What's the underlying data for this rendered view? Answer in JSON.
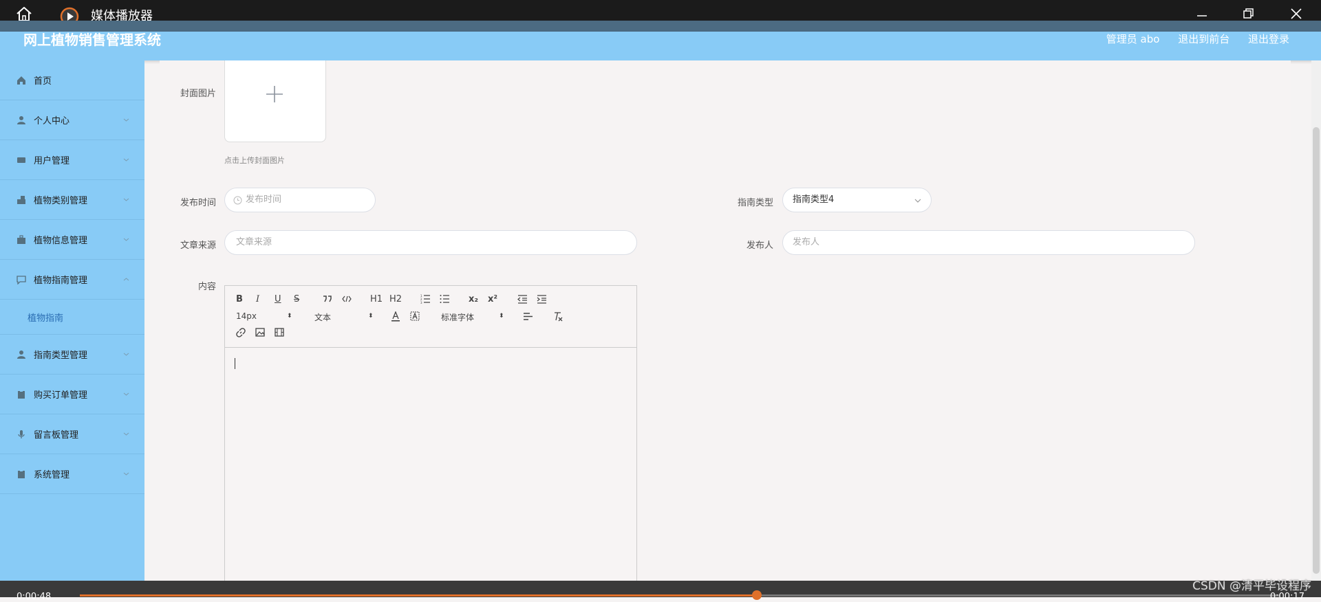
{
  "window": {
    "title": "媒体播放器"
  },
  "header": {
    "brand": "网上植物销售管理系统",
    "admin": "管理员 abo",
    "to_front": "退出到前台",
    "logout": "退出登录"
  },
  "sidebar": {
    "items": [
      {
        "label": "首页",
        "icon": "home-icon"
      },
      {
        "label": "个人中心",
        "icon": "user-icon"
      },
      {
        "label": "用户管理",
        "icon": "users-icon"
      },
      {
        "label": "植物类别管理",
        "icon": "category-icon"
      },
      {
        "label": "植物信息管理",
        "icon": "briefcase-icon"
      },
      {
        "label": "植物指南管理",
        "icon": "chat-icon",
        "expanded": true
      },
      {
        "label": "指南类型管理",
        "icon": "user-icon"
      },
      {
        "label": "购买订单管理",
        "icon": "clipboard-icon"
      },
      {
        "label": "留言板管理",
        "icon": "mic-icon"
      },
      {
        "label": "系统管理",
        "icon": "clipboard-icon"
      }
    ],
    "sub_item": "植物指南"
  },
  "form": {
    "cover_label": "封面图片",
    "cover_hint": "点击上传封面图片",
    "publish_time_label": "发布时间",
    "publish_time_placeholder": "发布时间",
    "guide_type_label": "指南类型",
    "guide_type_value": "指南类型4",
    "source_label": "文章来源",
    "source_placeholder": "文章来源",
    "publisher_label": "发布人",
    "publisher_placeholder": "发布人",
    "content_label": "内容"
  },
  "editor": {
    "bold": "B",
    "italic": "I",
    "underline": "U",
    "strike": "S",
    "h1": "H1",
    "h2": "H2",
    "sub": "x₂",
    "sup": "x²",
    "font_size": "14px",
    "block_type": "文本",
    "font_family": "标准字体"
  },
  "player": {
    "time_elapsed": "0:00:48",
    "time_remaining": "0:00:17",
    "progress": 0.564
  },
  "watermark": "CSDN @清平毕设程序",
  "colors": {
    "header": "#88cbf6",
    "sidebar": "#88cbf6",
    "accent": "#e0702a"
  }
}
